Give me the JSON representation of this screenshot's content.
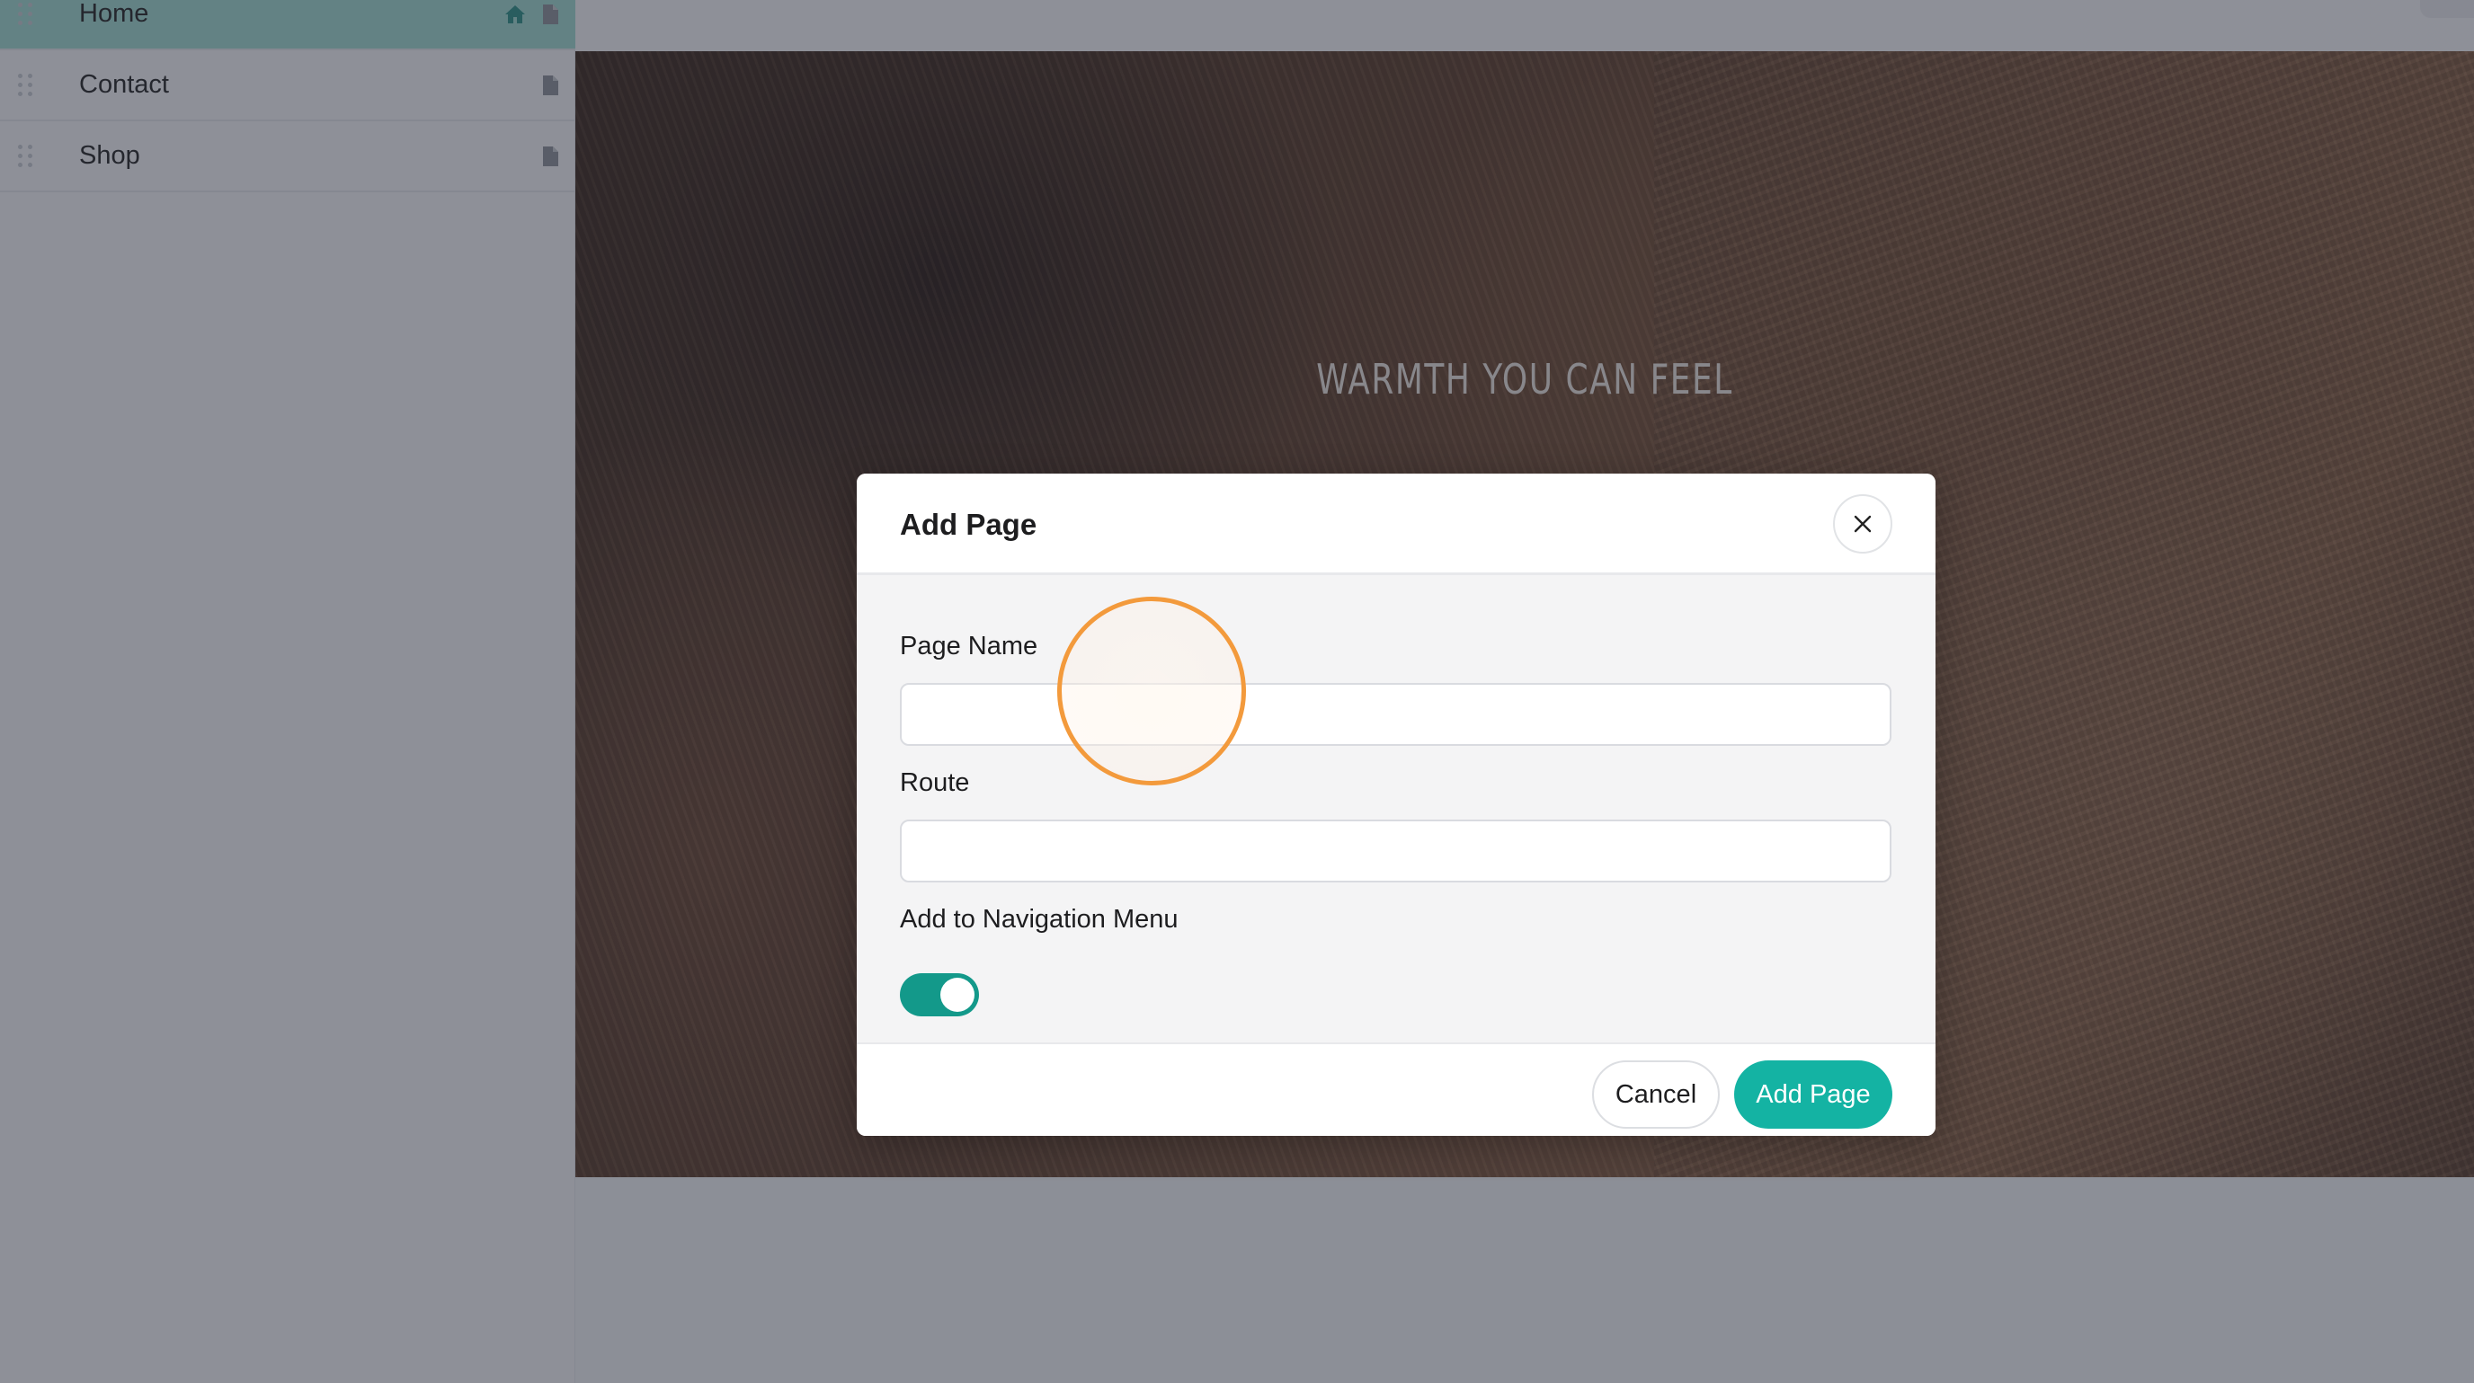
{
  "sidebar": {
    "items": [
      {
        "label": "Home",
        "is_home": true
      },
      {
        "label": "Contact",
        "is_home": false
      },
      {
        "label": "Shop",
        "is_home": false
      }
    ]
  },
  "hero": {
    "title": "WARMTH YOU CAN FEEL"
  },
  "modal": {
    "title": "Add Page",
    "fields": {
      "page_name": {
        "label": "Page Name",
        "value": "",
        "placeholder": ""
      },
      "route": {
        "label": "Route",
        "value": "",
        "placeholder": ""
      },
      "nav_menu": {
        "label": "Add to Navigation Menu",
        "checked": true
      }
    },
    "cancel_label": "Cancel",
    "submit_label": "Add Page"
  },
  "colors": {
    "accent": "#14b3a3",
    "toggle_on": "#13998a",
    "active_item_bg": "#9fd8cf",
    "click_ring": "#f39a3c"
  },
  "icons": [
    "drag-handle-icon",
    "home-icon",
    "page-icon",
    "close-icon"
  ]
}
